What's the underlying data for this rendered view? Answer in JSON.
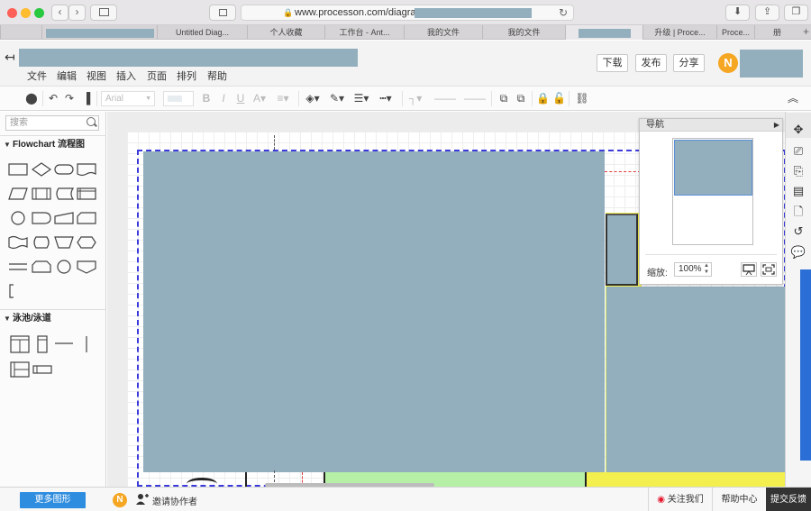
{
  "browser": {
    "url_visible": "www.processon.com/diagraming",
    "tabs": [
      {
        "label": ""
      },
      {
        "label": "Untitled Diag..."
      },
      {
        "label": "个人收藏"
      },
      {
        "label": "工作台 - Ant..."
      },
      {
        "label": "我的文件"
      },
      {
        "label": "我的文件"
      },
      {
        "label": ""
      },
      {
        "label": "升级 | Proce..."
      },
      {
        "label": "Proce..."
      },
      {
        "label": "册"
      }
    ]
  },
  "menu": [
    "文件",
    "编辑",
    "视图",
    "插入",
    "页面",
    "排列",
    "帮助"
  ],
  "header_buttons": {
    "download": "下载",
    "publish": "发布",
    "share": "分享"
  },
  "user": {
    "avatar_letter": "N"
  },
  "toolbar": {
    "font": "Arial"
  },
  "left_panel": {
    "search_placeholder": "搜索",
    "sections": [
      {
        "title": "Flowchart 流程图"
      },
      {
        "title": "泳池/泳道"
      }
    ]
  },
  "navigator": {
    "title": "导航",
    "zoom_label": "缩放:",
    "zoom_value": "100%"
  },
  "bottom": {
    "more_shapes": "更多图形",
    "avatar_letter": "N",
    "invite": "邀请协作者",
    "follow": "关注我们",
    "help": "帮助中心",
    "feedback": "提交反馈"
  },
  "colors": {
    "accent": "#2f8ddf",
    "avatar": "#f5a623",
    "redaction": "#93afbe",
    "page_boundary": "#3b3bdb"
  }
}
